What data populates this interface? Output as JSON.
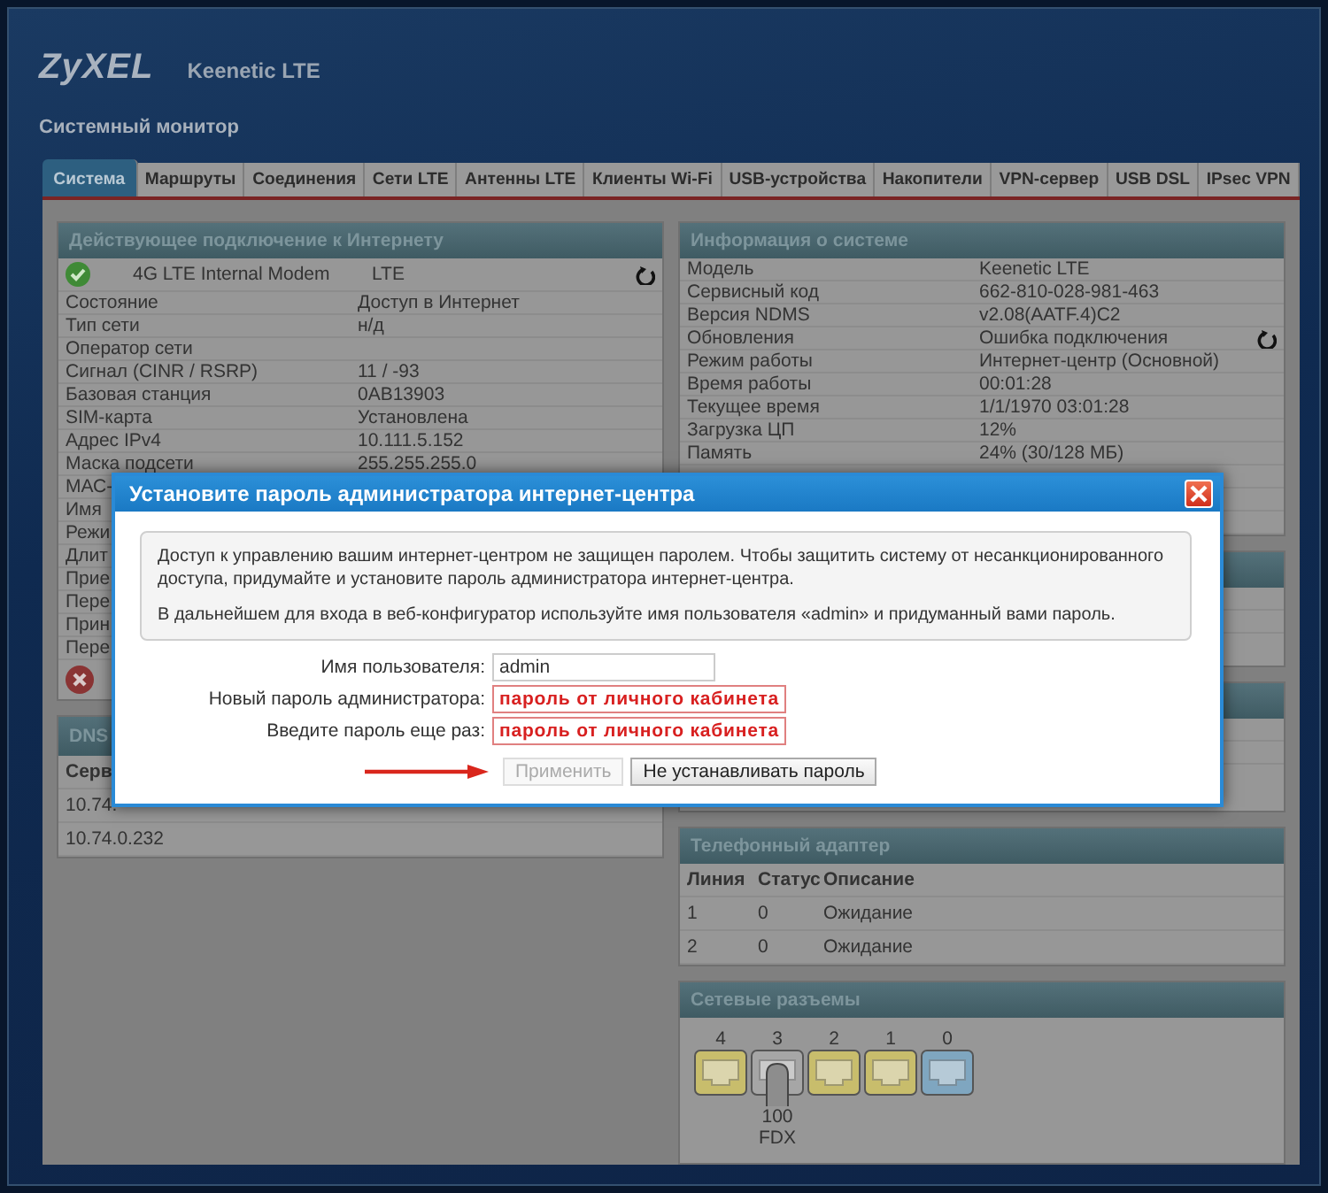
{
  "header": {
    "logo": "ZyXEL",
    "model": "Keenetic LTE",
    "page_title": "Системный монитор"
  },
  "tabs": [
    {
      "label": "Система",
      "selected": true
    },
    {
      "label": "Маршруты",
      "selected": false
    },
    {
      "label": "Соединения",
      "selected": false
    },
    {
      "label": "Сети LTE",
      "selected": false
    },
    {
      "label": "Антенны LTE",
      "selected": false
    },
    {
      "label": "Клиенты Wi-Fi",
      "selected": false
    },
    {
      "label": "USB-устройства",
      "selected": false
    },
    {
      "label": "Накопители",
      "selected": false
    },
    {
      "label": "VPN-сервер",
      "selected": false
    },
    {
      "label": "USB DSL",
      "selected": false
    },
    {
      "label": "IPsec VPN",
      "selected": false
    }
  ],
  "connection": {
    "title": "Действующее подключение к Интернету",
    "connected": true,
    "interface": "4G LTE Internal Modem",
    "type": "LTE",
    "rows": [
      {
        "label": "Состояние",
        "value": "Доступ в Интернет"
      },
      {
        "label": "Тип сети",
        "value": "н/д"
      },
      {
        "label": "Оператор сети"
      },
      {
        "label": "Сигнал (CINR / RSRP)",
        "value": "11 / -93"
      },
      {
        "label": "Базовая станция",
        "value": "0AB13903"
      },
      {
        "label": "SIM-карта",
        "value": "Установлена"
      },
      {
        "label": "Адрес IPv4",
        "value": "10.111.5.152"
      },
      {
        "label": "Маска подсети",
        "value": "255.255.255.0"
      },
      {
        "label": "МАС-"
      },
      {
        "label": "Имя"
      },
      {
        "label": "Режи"
      },
      {
        "label": "Длит"
      },
      {
        "label": "Прие"
      },
      {
        "label": "Пере"
      },
      {
        "label": "Прин"
      },
      {
        "label": "Пере"
      }
    ]
  },
  "dns": {
    "title": "DNS",
    "column": "Серв",
    "rows": [
      "10.74.",
      "10.74.0.232"
    ]
  },
  "system": {
    "title": "Информация о системе",
    "rows": [
      {
        "label": "Модель",
        "value": "Keenetic LTE",
        "kind": "plain"
      },
      {
        "label": "Сервисный код",
        "value": "662-810-028-981-463",
        "kind": "plain"
      },
      {
        "label": "Версия NDMS",
        "value": "v2.08(AATF.4)C2",
        "kind": "plain"
      },
      {
        "label": "Обновления",
        "value": "Ошибка подключения",
        "kind": "refresh"
      },
      {
        "label": "Режим работы",
        "value": "Интернет-центр (Основной)",
        "kind": "plain"
      },
      {
        "label": "Время работы",
        "value": "00:01:28",
        "kind": "plain"
      },
      {
        "label": "Текущее время",
        "value": "1/1/1970 03:01:28",
        "kind": "plain"
      },
      {
        "label": "Загрузка ЦП",
        "value": "12%",
        "kind": "plain"
      },
      {
        "label": "Память",
        "value": "24% (30/128 МБ)",
        "kind": "plain"
      }
    ]
  },
  "phone": {
    "title": "Телефонный адаптер",
    "columns": [
      "Линия",
      "Статус",
      "Описание"
    ],
    "rows": [
      [
        "1",
        "0",
        "Ожидание"
      ],
      [
        "2",
        "0",
        "Ожидание"
      ]
    ]
  },
  "ports": {
    "title": "Сетевые разъемы",
    "items": [
      {
        "label": "4",
        "color": "#c8bd6c",
        "connected": false
      },
      {
        "label": "3",
        "color": "#a6a6a6",
        "connected": true,
        "speed": "100",
        "duplex": "FDX"
      },
      {
        "label": "2",
        "color": "#c8bd6c",
        "connected": false
      },
      {
        "label": "1",
        "color": "#c8bd6c",
        "connected": false
      },
      {
        "label": "0",
        "color": "#7fa6c0",
        "connected": false
      }
    ]
  },
  "dialog": {
    "title": "Установите пароль администратора интернет-центра",
    "messages": [
      "Доступ к управлению вашим интернет-центром не защищен паролем. Чтобы защитить систему от несанкционированного доступа, придумайте и установите пароль администратора интернет-центра.",
      "В дальнейшем для входа в веб-конфигуратор используйте имя пользователя «admin» и придуманный вами пароль."
    ],
    "fields": [
      {
        "label": "Имя пользователя:",
        "value": "admin",
        "error": false
      },
      {
        "label": "Новый пароль администратора:",
        "value": "пароль от личного кабинета",
        "error": true
      },
      {
        "label": "Введите пароль еще раз:",
        "value": "пароль от личного кабинета",
        "error": true
      }
    ],
    "buttons": [
      {
        "label": "Применить",
        "disabled": true
      },
      {
        "label": "Не устанавливать пароль",
        "disabled": false
      }
    ]
  }
}
